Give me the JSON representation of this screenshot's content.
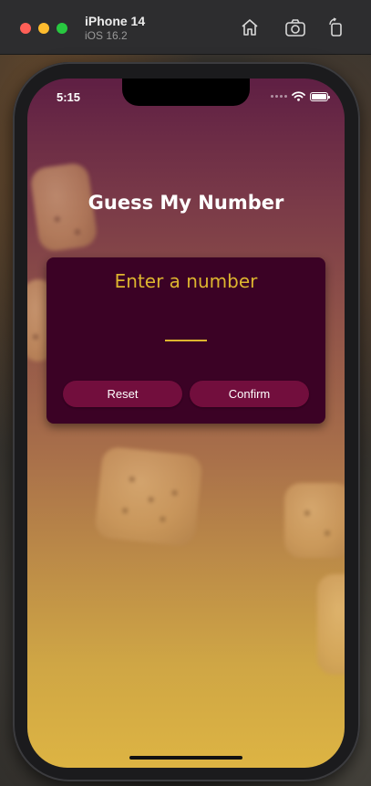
{
  "simulator": {
    "device_name": "iPhone 14",
    "os_version": "iOS 16.2",
    "icons": [
      "home-icon",
      "screenshot-icon",
      "rotate-icon"
    ]
  },
  "status_bar": {
    "time": "5:15",
    "icons": [
      "cellular-dots-icon",
      "wifi-icon",
      "battery-icon"
    ],
    "battery_level": 1.0
  },
  "app": {
    "title": "Guess My Number",
    "card": {
      "heading": "Enter a number",
      "input_value": "",
      "reset_label": "Reset",
      "confirm_label": "Confirm"
    }
  },
  "colors": {
    "accent": "#ddb52f",
    "card_background": "#3b0225",
    "button_background": "#720e3d",
    "gradient_top": "#5f1f44",
    "gradient_bottom": "#ddb443"
  }
}
